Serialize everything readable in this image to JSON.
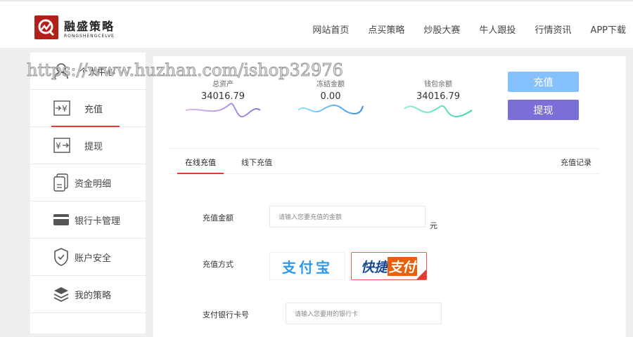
{
  "logo": {
    "cn": "融盛策略",
    "en": "RONGSHENGCELVE"
  },
  "nav": [
    "网站首页",
    "点买策略",
    "炒股大赛",
    "牛人跟投",
    "行情资讯",
    "APP下载"
  ],
  "sidebar": [
    "个人中心",
    "充值",
    "提现",
    "资金明细",
    "银行卡管理",
    "账户安全",
    "我的策略"
  ],
  "stats": [
    {
      "label": "总资产",
      "value": "34016.79"
    },
    {
      "label": "冻结金额",
      "value": "0.00"
    },
    {
      "label": "钱包余额",
      "value": "34016.79"
    }
  ],
  "buttons": {
    "recharge": "充值",
    "withdraw": "提现"
  },
  "tabs": {
    "online": "在线充值",
    "offline": "线下充值",
    "records": "充值记录"
  },
  "form": {
    "amount_label": "充值金额",
    "amount_placeholder": "请输入您要充值的金额",
    "unit": "元",
    "method_label": "充值方式",
    "alipay": "支付宝",
    "quick_a": "快捷",
    "quick_b": "支付",
    "card_label": "支付银行卡号",
    "card_placeholder": "请输入您要用的银行卡"
  },
  "watermark": "https://www.huzhan.com/ishop32976",
  "colors": {
    "accent": "#e8382f",
    "recharge": "#85c1ff",
    "withdraw": "#7a6fd6"
  }
}
